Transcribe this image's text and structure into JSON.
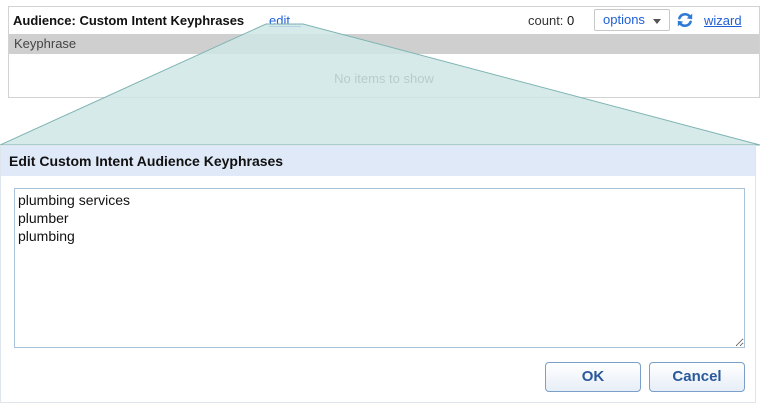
{
  "panel": {
    "title": "Audience: Custom Intent Keyphrases",
    "edit_link": "edit...",
    "count_label": "count:",
    "count_value": "0",
    "options_label": "options",
    "refresh_icon": "refresh-icon",
    "wizard_link": "wizard",
    "column_header": "Keyphrase",
    "empty_message": "No items to show"
  },
  "dialog": {
    "title": "Edit Custom Intent Audience Keyphrases",
    "keyphrases_value": "plumbing services\nplumber\nplumbing",
    "ok_label": "OK",
    "cancel_label": "Cancel"
  },
  "colors": {
    "link": "#1f5fd6",
    "dialog_header_bg": "#dfe9f7",
    "wedge_fill": "#cfe6e6",
    "column_header_bg": "#cfcfcf",
    "refresh_icon": "#2f7ad6",
    "button_text": "#2a5a9a"
  }
}
